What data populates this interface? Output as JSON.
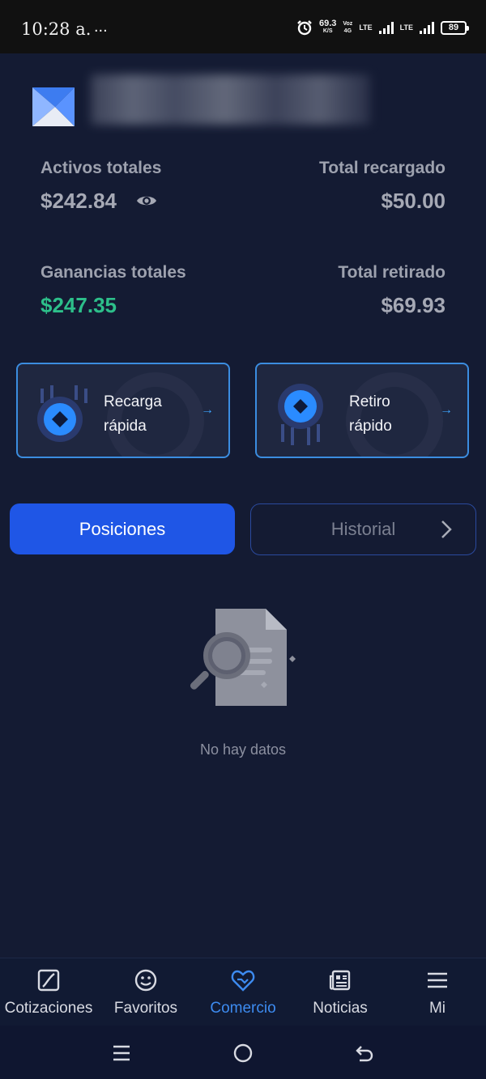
{
  "status_bar": {
    "time": "10:28 a.",
    "dots": "...",
    "speed": "69.3",
    "speed_unit": "K/S",
    "voz": "Voz",
    "net_4g": "4G",
    "lte1": "LTE",
    "lte2": "LTE",
    "battery": "89"
  },
  "stats": {
    "assets_label": "Activos totales",
    "assets_value": "$242.84",
    "recharged_label": "Total recargado",
    "recharged_value": "$50.00",
    "earnings_label": "Ganancias totales",
    "earnings_value": "$247.35",
    "withdrawn_label": "Total retirado",
    "withdrawn_value": "$69.93"
  },
  "quick_actions": {
    "recharge_label": "Recarga rápida",
    "withdraw_label": "Retiro rápido",
    "arrow": "→"
  },
  "tabs": {
    "positions": "Posiciones",
    "history": "Historial"
  },
  "empty_state": {
    "text": "No hay datos"
  },
  "bottom_nav": [
    {
      "label": "Cotizaciones",
      "icon": "chart-icon"
    },
    {
      "label": "Favoritos",
      "icon": "smiley-icon"
    },
    {
      "label": "Comercio",
      "icon": "handshake-heart-icon"
    },
    {
      "label": "Noticias",
      "icon": "newspaper-icon"
    },
    {
      "label": "Mi",
      "icon": "menu-icon"
    }
  ],
  "colors": {
    "background": "#141b33",
    "accent_blue": "#1f56e6",
    "earnings_green": "#2dbf8a",
    "active_nav": "#3d8bf0",
    "card_border": "#3b8de0"
  }
}
